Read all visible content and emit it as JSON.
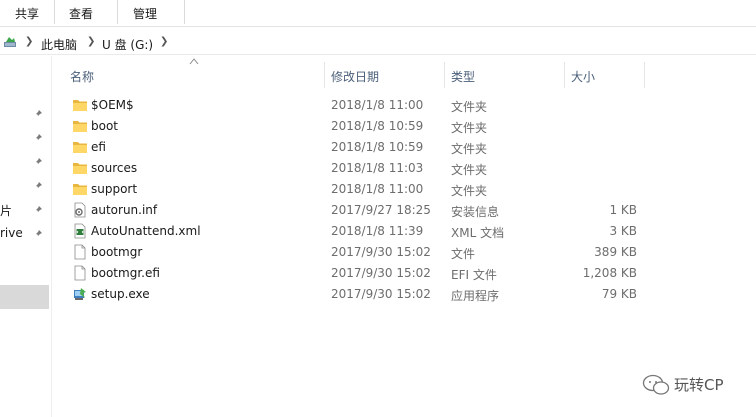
{
  "ribbon": {
    "tabs": [
      "共享",
      "查看",
      "管理"
    ]
  },
  "address": {
    "crumbs": [
      "此电脑",
      "U 盘 (G:)"
    ]
  },
  "nav": {
    "items": [
      "片",
      "rive"
    ]
  },
  "columns": {
    "name": "名称",
    "date": "修改日期",
    "type": "类型",
    "size": "大小"
  },
  "files": [
    {
      "name": "$OEM$",
      "date": "2018/1/8 11:00",
      "type": "文件夹",
      "size": "",
      "icon": "folder-icon"
    },
    {
      "name": "boot",
      "date": "2018/1/8 10:59",
      "type": "文件夹",
      "size": "",
      "icon": "folder-icon"
    },
    {
      "name": "efi",
      "date": "2018/1/8 10:59",
      "type": "文件夹",
      "size": "",
      "icon": "folder-icon"
    },
    {
      "name": "sources",
      "date": "2018/1/8 11:03",
      "type": "文件夹",
      "size": "",
      "icon": "folder-icon"
    },
    {
      "name": "support",
      "date": "2018/1/8 11:00",
      "type": "文件夹",
      "size": "",
      "icon": "folder-icon"
    },
    {
      "name": "autorun.inf",
      "date": "2017/9/27 18:25",
      "type": "安装信息",
      "size": "1 KB",
      "icon": "setup-info-icon"
    },
    {
      "name": "AutoUnattend.xml",
      "date": "2018/1/8 11:39",
      "type": "XML 文档",
      "size": "3 KB",
      "icon": "xml-document-icon"
    },
    {
      "name": "bootmgr",
      "date": "2017/9/30 15:02",
      "type": "文件",
      "size": "389 KB",
      "icon": "file-icon"
    },
    {
      "name": "bootmgr.efi",
      "date": "2017/9/30 15:02",
      "type": "EFI 文件",
      "size": "1,208 KB",
      "icon": "file-icon"
    },
    {
      "name": "setup.exe",
      "date": "2017/9/30 15:02",
      "type": "应用程序",
      "size": "79 KB",
      "icon": "setup-exe-icon"
    }
  ],
  "watermark": {
    "text": "玩转CP"
  }
}
